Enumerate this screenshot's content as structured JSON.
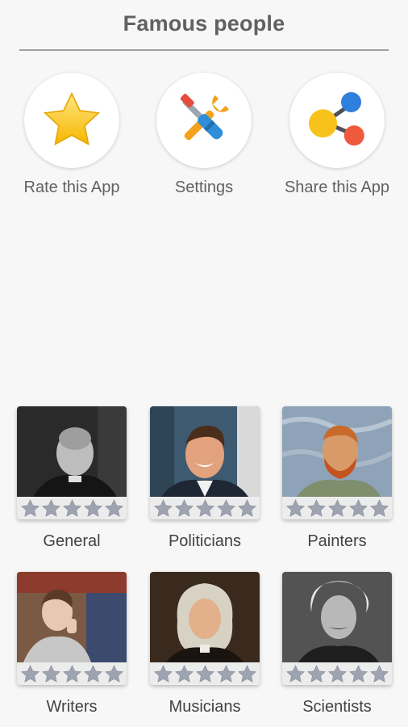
{
  "header": {
    "title": "Famous people"
  },
  "actions": [
    {
      "label": "Rate this App",
      "icon": "star-icon"
    },
    {
      "label": "Settings",
      "icon": "tools-icon"
    },
    {
      "label": "Share this App",
      "icon": "share-icon"
    }
  ],
  "categories": [
    {
      "label": "General",
      "stars_filled": 0,
      "stars_total": 5
    },
    {
      "label": "Politicians",
      "stars_filled": 0,
      "stars_total": 5
    },
    {
      "label": "Painters",
      "stars_filled": 0,
      "stars_total": 5
    },
    {
      "label": "Writers",
      "stars_filled": 0,
      "stars_total": 5
    },
    {
      "label": "Musicians",
      "stars_filled": 0,
      "stars_total": 5
    },
    {
      "label": "Scientists",
      "stars_filled": 0,
      "stars_total": 5
    }
  ],
  "colors": {
    "background": "#f7f7f7",
    "title_text": "#616161",
    "star_empty": "#9ea3b0",
    "rate_star": "#f8c21c"
  }
}
